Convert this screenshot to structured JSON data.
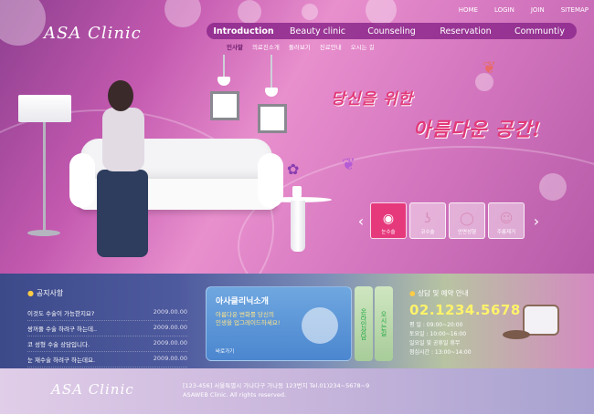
{
  "logo": "ASA Clinic",
  "util_links": [
    "HOME",
    "LOGIN",
    "JOIN",
    "SITEMAP"
  ],
  "nav": [
    "Introduction",
    "Beauty clinic",
    "Counseling",
    "Reservation",
    "Communtiy"
  ],
  "subnav": [
    "인사말",
    "의료진소개",
    "둘러보기",
    "진료안내",
    "오시는 길"
  ],
  "tagline_line1": "당신을 위한",
  "tagline_line2": "아름다운 공간!",
  "thumbs": [
    "눈수술",
    "코수술",
    "안면성형",
    "주름제거"
  ],
  "notice": {
    "title": "공지사항",
    "rows": [
      {
        "text": "이것도 수술이 가능한지요?",
        "date": "2009.00.00"
      },
      {
        "text": "쌍꺼풀 수술 하려구 하는데..",
        "date": "2009.00.00"
      },
      {
        "text": "코 성형 수술 상담입니다.",
        "date": "2009.00.00"
      },
      {
        "text": "눈 재수술 하려구 하는데요.",
        "date": "2009.00.00"
      }
    ]
  },
  "intro": {
    "title": "아사클리닉소개",
    "desc_line1": "아름다운 변화를 당신의",
    "desc_line2": "인생을 업그레이드하세요!",
    "link": "바로가기"
  },
  "side_tabs": [
    "온라인상담",
    "오시는길"
  ],
  "contact": {
    "title": "상담 및 예약 안내",
    "phone": "02.1234.5678",
    "hours": [
      "평 일 : 09:00~20:00",
      "토요일 : 10:00~16:00",
      "일요일 및 공휴일 휴무",
      "점심시간 : 13:00~14:00"
    ]
  },
  "footer": {
    "logo": "ASA Clinic",
    "address": "[123-456] 서울특별시 가나다구 가나동 123번지 Tel.01)234~5678~9",
    "copyright": "ASAWEB Clinic.  All rights reserved."
  }
}
